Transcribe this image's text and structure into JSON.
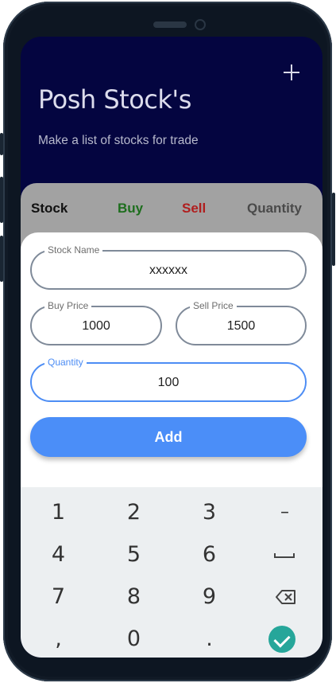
{
  "header": {
    "add_icon": "plus-icon",
    "title": "Posh Stock's",
    "subtitle": "Make a list of stocks for trade"
  },
  "columns": {
    "stock": "Stock",
    "buy": "Buy",
    "sell": "Sell",
    "quantity": "Quantity"
  },
  "form": {
    "stock_name": {
      "label": "Stock Name",
      "value": "xxxxxx"
    },
    "buy_price": {
      "label": "Buy Price",
      "value": "1000"
    },
    "sell_price": {
      "label": "Sell Price",
      "value": "1500"
    },
    "quantity": {
      "label": "Quantity",
      "value": "100"
    },
    "add_label": "Add"
  },
  "keyboard": {
    "row1": [
      "1",
      "2",
      "3",
      "–"
    ],
    "row2": [
      "4",
      "5",
      "6"
    ],
    "row3": [
      "7",
      "8",
      "9"
    ],
    "row4": [
      ",",
      "0",
      "."
    ],
    "icons": [
      "space-icon",
      "backspace-icon",
      "check-icon"
    ]
  },
  "colors": {
    "background": "#040540",
    "accent": "#4b8ef8",
    "buy": "#1d6e1d",
    "sell": "#b01e1e",
    "done": "#26a69a"
  }
}
